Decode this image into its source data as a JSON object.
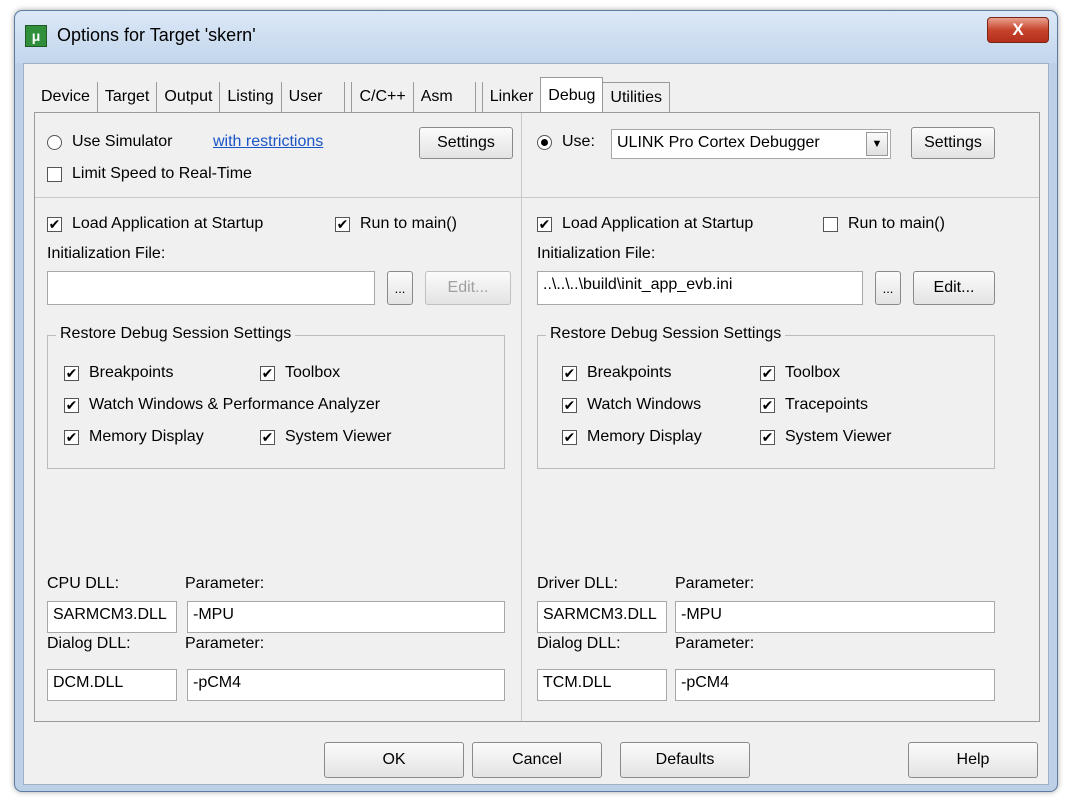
{
  "window": {
    "title": "Options for Target 'skern'",
    "close_glyph": "X"
  },
  "tabs": [
    "Device",
    "Target",
    "Output",
    "Listing",
    "User",
    "C/C++",
    "Asm",
    "Linker",
    "Debug",
    "Utilities"
  ],
  "active_tab": "Debug",
  "left": {
    "use_simulator_label": "Use Simulator",
    "restrictions_link": "with restrictions",
    "settings_label": "Settings",
    "limit_speed_label": "Limit Speed to Real-Time",
    "load_app_label": "Load Application at Startup",
    "run_to_main_label": "Run to main()",
    "init_file_label": "Initialization File:",
    "init_file_value": "",
    "browse_label": "...",
    "edit_label": "Edit...",
    "restore_title": "Restore Debug Session Settings",
    "restore": {
      "breakpoints": "Breakpoints",
      "toolbox": "Toolbox",
      "watch": "Watch Windows & Performance Analyzer",
      "memory": "Memory Display",
      "system_viewer": "System Viewer"
    },
    "cpu_dll_label": "CPU DLL:",
    "cpu_param_label": "Parameter:",
    "cpu_dll_value": "SARMCM3.DLL",
    "cpu_param_value": "-MPU",
    "dialog_dll_label": "Dialog DLL:",
    "dialog_param_label": "Parameter:",
    "dialog_dll_value": "DCM.DLL",
    "dialog_param_value": "-pCM4"
  },
  "right": {
    "use_label": "Use:",
    "debugger_value": "ULINK Pro Cortex Debugger",
    "settings_label": "Settings",
    "load_app_label": "Load Application at Startup",
    "run_to_main_label": "Run to main()",
    "init_file_label": "Initialization File:",
    "init_file_value": "..\\..\\..\\build\\init_app_evb.ini",
    "browse_label": "...",
    "edit_label": "Edit...",
    "restore_title": "Restore Debug Session Settings",
    "restore": {
      "breakpoints": "Breakpoints",
      "toolbox": "Toolbox",
      "watch": "Watch Windows",
      "tracepoints": "Tracepoints",
      "memory": "Memory Display",
      "system_viewer": "System Viewer"
    },
    "driver_dll_label": "Driver DLL:",
    "driver_param_label": "Parameter:",
    "driver_dll_value": "SARMCM3.DLL",
    "driver_param_value": "-MPU",
    "dialog_dll_label": "Dialog DLL:",
    "dialog_param_label": "Parameter:",
    "dialog_dll_value": "TCM.DLL",
    "dialog_param_value": "-pCM4"
  },
  "footer": {
    "ok": "OK",
    "cancel": "Cancel",
    "defaults": "Defaults",
    "help": "Help"
  },
  "check_glyph": "✔"
}
